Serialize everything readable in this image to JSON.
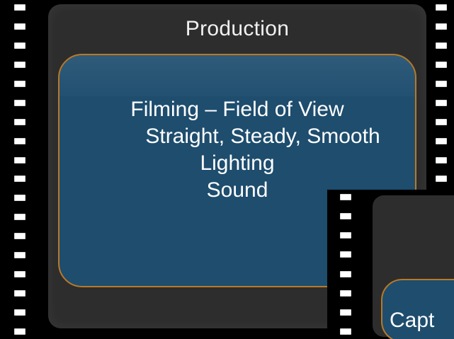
{
  "slide": {
    "title": "Production",
    "content_lines": [
      "Filming – Field of View",
      "Straight, Steady, Smooth",
      "Lighting",
      "Sound"
    ]
  },
  "secondary_slide": {
    "caption": "Capt"
  },
  "colors": {
    "frame": "#2d2d2d",
    "content_box": "#1e4d6e",
    "content_border": "#b87928",
    "film": "#000000",
    "text": "#ffffff"
  }
}
